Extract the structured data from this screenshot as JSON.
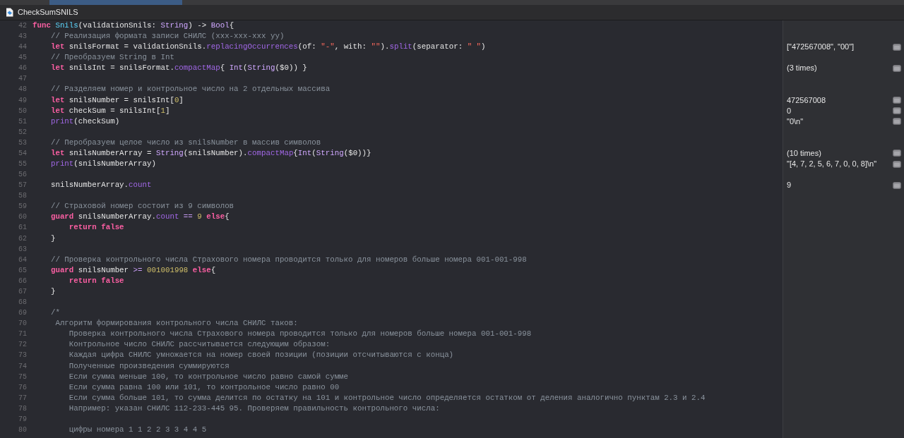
{
  "window": {
    "title": "CheckSumSNILS"
  },
  "lines": [
    {
      "number": "42",
      "tokens": [
        {
          "kind": "kw",
          "text": "func"
        },
        {
          "kind": "decl",
          "text": " Snils"
        },
        {
          "kind": "plain",
          "text": "(validationSnils: "
        },
        {
          "kind": "type",
          "text": "String"
        },
        {
          "kind": "plain",
          "text": ") -> "
        },
        {
          "kind": "type",
          "text": "Bool"
        },
        {
          "kind": "plain",
          "text": "{"
        }
      ]
    },
    {
      "number": "43",
      "tokens": [
        {
          "kind": "comment",
          "text": "    // Реализация формата записи СНИЛС (xxx-xxx-xxx yy)"
        }
      ]
    },
    {
      "number": "44",
      "tokens": [
        {
          "kind": "kw",
          "text": "    let"
        },
        {
          "kind": "plain",
          "text": " snilsFormat = validationSnils."
        },
        {
          "kind": "call",
          "text": "replacingOccurrences"
        },
        {
          "kind": "plain",
          "text": "(of: "
        },
        {
          "kind": "str",
          "text": "\"-\""
        },
        {
          "kind": "plain",
          "text": ", with: "
        },
        {
          "kind": "str",
          "text": "\"\""
        },
        {
          "kind": "plain",
          "text": ")."
        },
        {
          "kind": "call",
          "text": "split"
        },
        {
          "kind": "plain",
          "text": "(separator: "
        },
        {
          "kind": "str",
          "text": "\" \""
        },
        {
          "kind": "plain",
          "text": ")"
        }
      ],
      "result": "[\"472567008\", \"00\"]"
    },
    {
      "number": "45",
      "tokens": [
        {
          "kind": "comment",
          "text": "    // Преобразуем String в Int"
        }
      ]
    },
    {
      "number": "46",
      "tokens": [
        {
          "kind": "kw",
          "text": "    let"
        },
        {
          "kind": "plain",
          "text": " snilsInt = snilsFormat."
        },
        {
          "kind": "call",
          "text": "compactMap"
        },
        {
          "kind": "plain",
          "text": "{ "
        },
        {
          "kind": "type",
          "text": "Int"
        },
        {
          "kind": "plain",
          "text": "("
        },
        {
          "kind": "type",
          "text": "String"
        },
        {
          "kind": "plain",
          "text": "($0)) }"
        }
      ],
      "result": "(3 times)"
    },
    {
      "number": "47"
    },
    {
      "number": "48",
      "tokens": [
        {
          "kind": "comment",
          "text": "    // Разделяем номер и контрольное число на 2 отдельных массива"
        }
      ]
    },
    {
      "number": "49",
      "tokens": [
        {
          "kind": "kw",
          "text": "    let"
        },
        {
          "kind": "plain",
          "text": " snilsNumber = snilsInt["
        },
        {
          "kind": "num",
          "text": "0"
        },
        {
          "kind": "plain",
          "text": "]"
        }
      ],
      "result": "472567008"
    },
    {
      "number": "50",
      "tokens": [
        {
          "kind": "kw",
          "text": "    let"
        },
        {
          "kind": "plain",
          "text": " checkSum = snilsInt["
        },
        {
          "kind": "num",
          "text": "1"
        },
        {
          "kind": "plain",
          "text": "]"
        }
      ],
      "result": "0"
    },
    {
      "number": "51",
      "tokens": [
        {
          "kind": "call",
          "text": "    print"
        },
        {
          "kind": "plain",
          "text": "(checkSum)"
        }
      ],
      "result": "\"0\\n\""
    },
    {
      "number": "52"
    },
    {
      "number": "53",
      "tokens": [
        {
          "kind": "comment",
          "text": "    // Перобразуем целое число из snilsNumber в массив символов"
        }
      ]
    },
    {
      "number": "54",
      "tokens": [
        {
          "kind": "kw",
          "text": "    let"
        },
        {
          "kind": "plain",
          "text": " snilsNumberArray = "
        },
        {
          "kind": "type",
          "text": "String"
        },
        {
          "kind": "plain",
          "text": "(snilsNumber)."
        },
        {
          "kind": "call",
          "text": "compactMap"
        },
        {
          "kind": "plain",
          "text": "{"
        },
        {
          "kind": "type",
          "text": "Int"
        },
        {
          "kind": "plain",
          "text": "("
        },
        {
          "kind": "type",
          "text": "String"
        },
        {
          "kind": "plain",
          "text": "($0))}"
        }
      ],
      "result": "(10 times)"
    },
    {
      "number": "55",
      "tokens": [
        {
          "kind": "call",
          "text": "    print"
        },
        {
          "kind": "plain",
          "text": "(snilsNumberArray)"
        }
      ],
      "result": "\"[4, 7, 2, 5, 6, 7, 0, 0, 8]\\n\""
    },
    {
      "number": "56"
    },
    {
      "number": "57",
      "tokens": [
        {
          "kind": "plain",
          "text": "    snilsNumberArray."
        },
        {
          "kind": "call",
          "text": "count"
        }
      ],
      "result": "9"
    },
    {
      "number": "58"
    },
    {
      "number": "59",
      "tokens": [
        {
          "kind": "comment",
          "text": "    // Страховой номер состоит из 9 символов"
        }
      ]
    },
    {
      "number": "60",
      "tokens": [
        {
          "kind": "kw",
          "text": "    guard"
        },
        {
          "kind": "plain",
          "text": " snilsNumberArray."
        },
        {
          "kind": "call",
          "text": "count"
        },
        {
          "kind": "op",
          "text": " =="
        },
        {
          "kind": "num",
          "text": " 9"
        },
        {
          "kind": "kw",
          "text": " else"
        },
        {
          "kind": "plain",
          "text": "{"
        }
      ]
    },
    {
      "number": "61",
      "tokens": [
        {
          "kind": "kw",
          "text": "        return false"
        }
      ]
    },
    {
      "number": "62",
      "tokens": [
        {
          "kind": "plain",
          "text": "    }"
        }
      ]
    },
    {
      "number": "63"
    },
    {
      "number": "64",
      "tokens": [
        {
          "kind": "comment",
          "text": "    // Проверка контрольного числа Страхового номера проводится только для номеров больше номера 001-001-998"
        }
      ]
    },
    {
      "number": "65",
      "tokens": [
        {
          "kind": "kw",
          "text": "    guard"
        },
        {
          "kind": "plain",
          "text": " snilsNumber"
        },
        {
          "kind": "op",
          "text": " >="
        },
        {
          "kind": "num",
          "text": " 001001998"
        },
        {
          "kind": "kw",
          "text": " else"
        },
        {
          "kind": "plain",
          "text": "{"
        }
      ]
    },
    {
      "number": "66",
      "tokens": [
        {
          "kind": "kw",
          "text": "        return false"
        }
      ]
    },
    {
      "number": "67",
      "tokens": [
        {
          "kind": "plain",
          "text": "    }"
        }
      ]
    },
    {
      "number": "68"
    },
    {
      "number": "69",
      "tokens": [
        {
          "kind": "comment",
          "text": "    /*"
        }
      ]
    },
    {
      "number": "70",
      "tokens": [
        {
          "kind": "comment",
          "text": "     Алгоритм формирования контрольного числа СНИЛС таков:"
        }
      ]
    },
    {
      "number": "71",
      "tokens": [
        {
          "kind": "comment",
          "text": "        Проверка контрольного числа Страхового номера проводится только для номеров больше номера 001-001-998"
        }
      ]
    },
    {
      "number": "72",
      "tokens": [
        {
          "kind": "comment",
          "text": "        Контрольное число СНИЛС рассчитывается следующим образом:"
        }
      ]
    },
    {
      "number": "73",
      "tokens": [
        {
          "kind": "comment",
          "text": "        Каждая цифра СНИЛС умножается на номер своей позиции (позиции отсчитываются с конца)"
        }
      ]
    },
    {
      "number": "74",
      "tokens": [
        {
          "kind": "comment",
          "text": "        Полученные произведения суммируются"
        }
      ]
    },
    {
      "number": "75",
      "tokens": [
        {
          "kind": "comment",
          "text": "        Если сумма меньше 100, то контрольное число равно самой сумме"
        }
      ]
    },
    {
      "number": "76",
      "tokens": [
        {
          "kind": "comment",
          "text": "        Если сумма равна 100 или 101, то контрольное число равно 00"
        }
      ]
    },
    {
      "number": "77",
      "tokens": [
        {
          "kind": "comment",
          "text": "        Если сумма больше 101, то сумма делится по остатку на 101 и контрольное число определяется остатком от деления аналогично пунктам 2.3 и 2.4"
        }
      ]
    },
    {
      "number": "78",
      "tokens": [
        {
          "kind": "comment",
          "text": "        Например: указан СНИЛС 112-233-445 95. Проверяем правильность контрольного числа:"
        }
      ]
    },
    {
      "number": "79"
    },
    {
      "number": "80",
      "tokens": [
        {
          "kind": "comment",
          "text": "        цифры номера 1 1 2 2 3 3 4 4 5"
        }
      ]
    }
  ]
}
